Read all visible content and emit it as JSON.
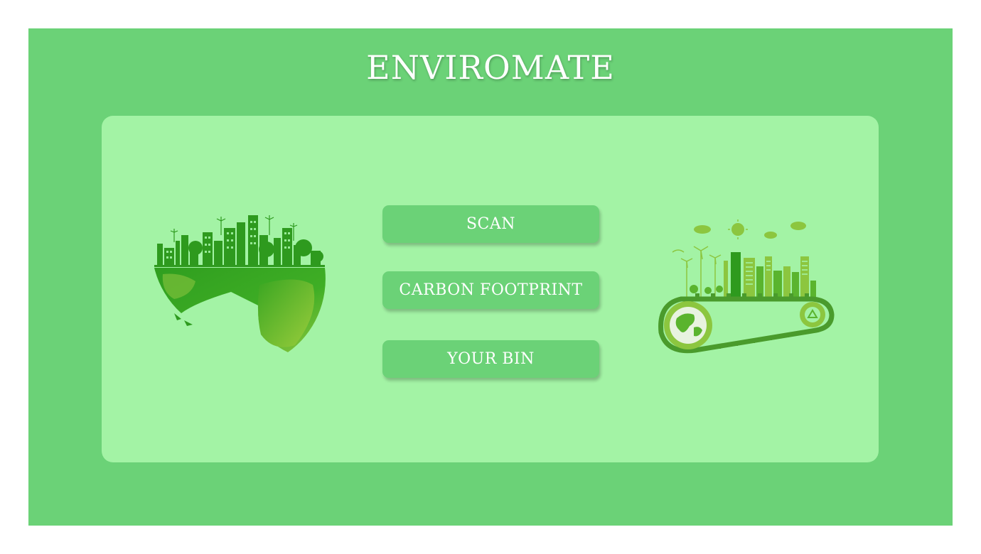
{
  "app": {
    "title": "ENVIROMATE"
  },
  "buttons": {
    "scan": "SCAN",
    "carbon_footprint": "CARBON FOOTPRINT",
    "your_bin": "YOUR BIN"
  },
  "illustrations": {
    "left": "eco-city-globe-icon",
    "right": "eco-city-conveyor-gear-icon"
  },
  "colors": {
    "frame": "#6bd277",
    "panel": "#a3f3a5",
    "button": "#6bd277",
    "text": "#ffffff",
    "illustration_dark": "#2e9a1e",
    "illustration_light": "#8bc53f"
  }
}
